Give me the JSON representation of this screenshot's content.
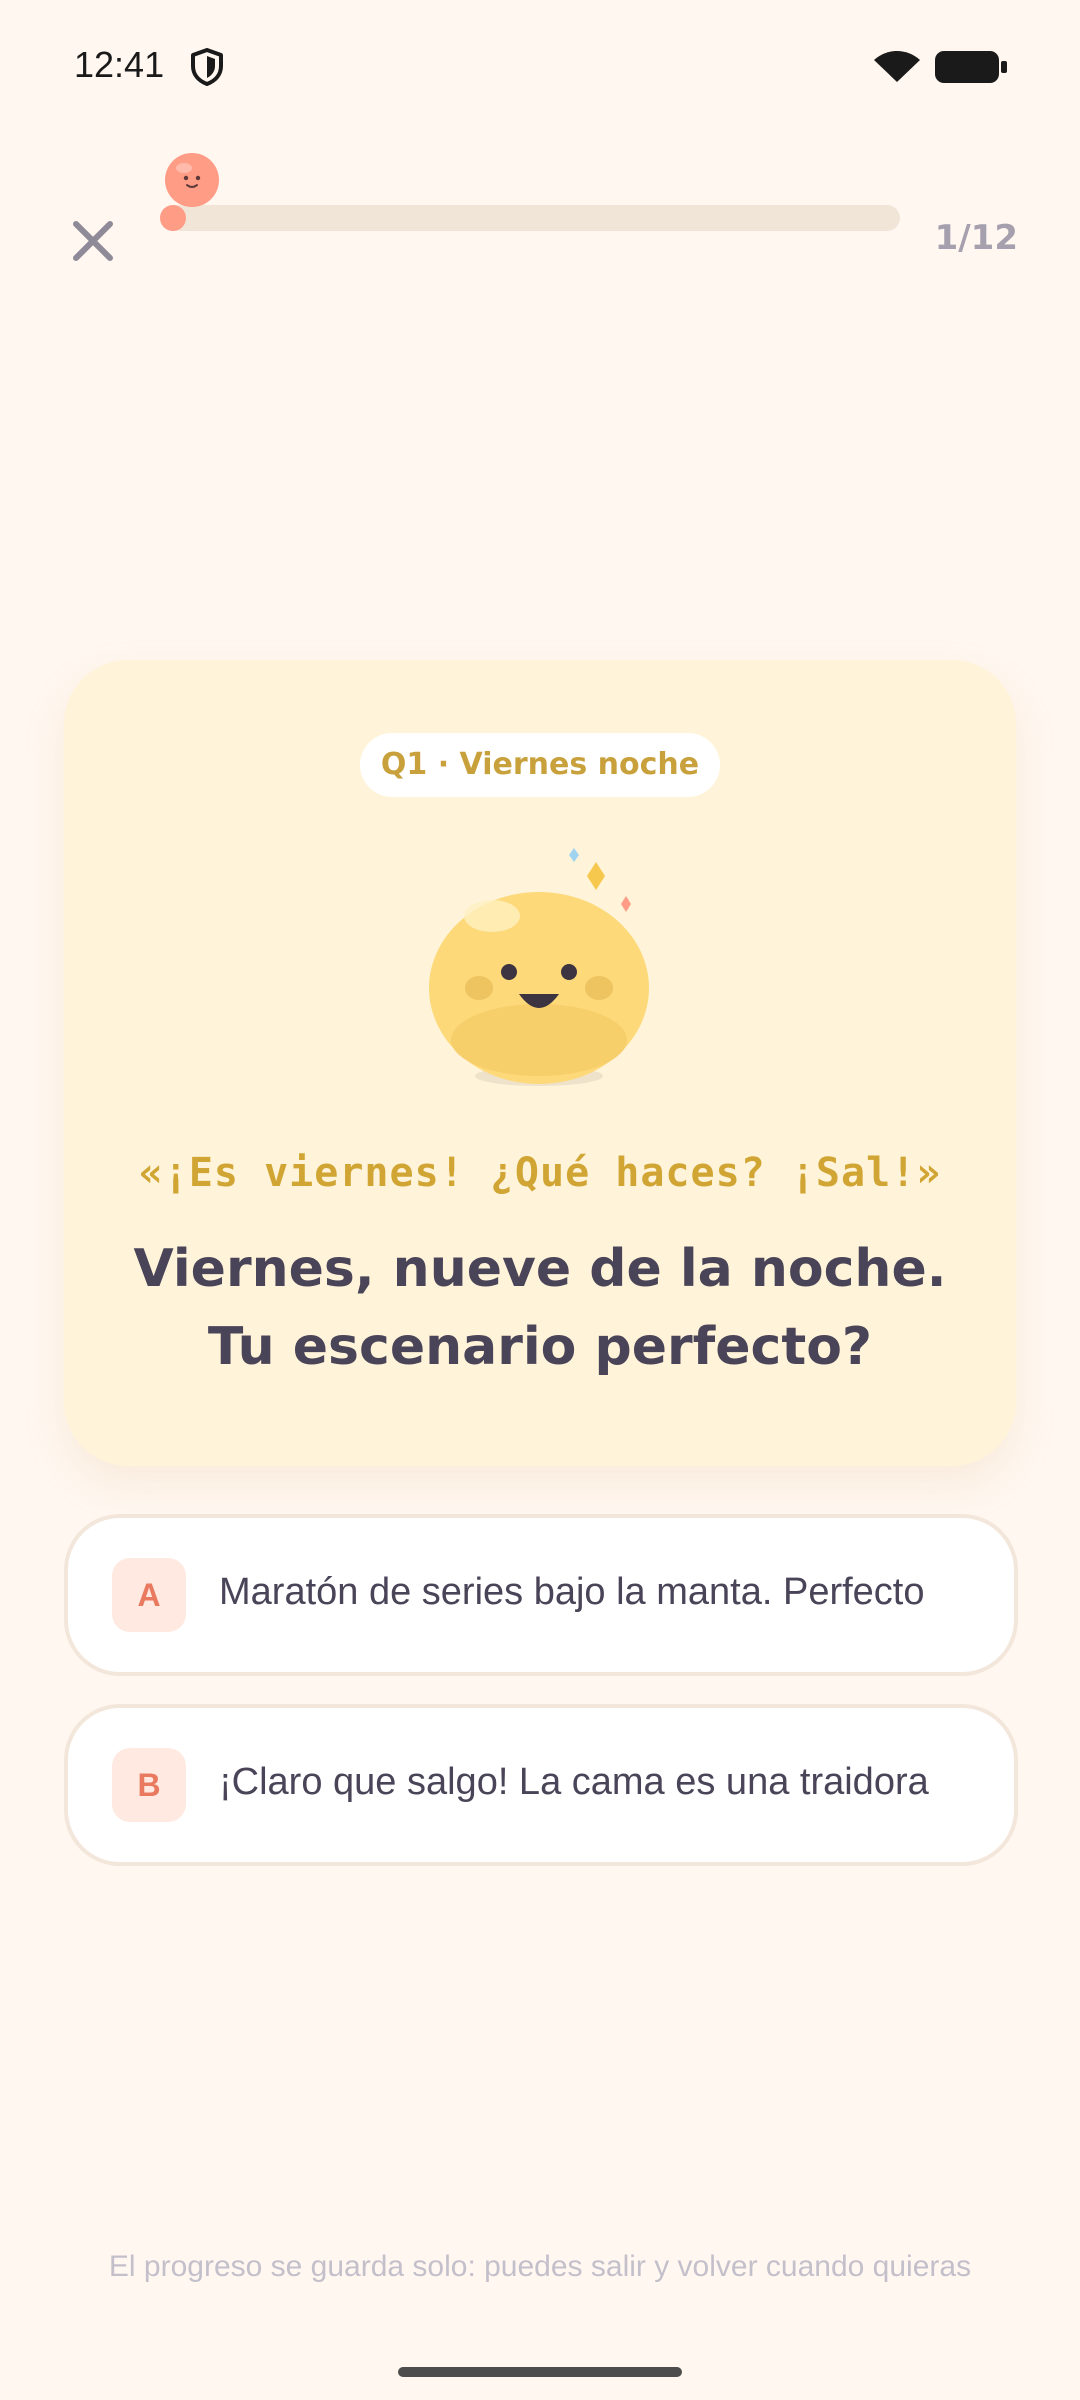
{
  "status_bar": {
    "time": "12:41",
    "icons": [
      "shield-icon",
      "wifi-icon",
      "battery-icon"
    ]
  },
  "header": {
    "close_icon": "close-icon",
    "progress": {
      "current": 1,
      "total": 12,
      "fraction": 0.02,
      "label": "1/12"
    },
    "colors": {
      "track": "#F1E5D8",
      "fill": "#FF9C86"
    }
  },
  "question": {
    "pill": "Q1 · Viernes noche",
    "quote": "«¡Es viernes! ¿Qué haces? ¡Sal!»",
    "title_line1": "Viernes, nueve de la noche.",
    "title_line2": "Tu escenario perfecto?",
    "colors": {
      "card_bg": "#FFF4D9",
      "accent": "#D1A533"
    }
  },
  "options": [
    {
      "letter": "A",
      "text": "Maratón de series bajo la manta. Perfecto"
    },
    {
      "letter": "B",
      "text": "¡Claro que salgo! La cama es una traidora"
    }
  ],
  "footer": {
    "hint": "El progreso se guarda solo: puedes salir y volver cuando quieras"
  },
  "colors": {
    "background": "#FFF7F0",
    "text": "#4A4458",
    "muted": "#A6A0AE",
    "option_letter": "#E97A5F",
    "option_letter_bg": "#FFE9E0"
  }
}
